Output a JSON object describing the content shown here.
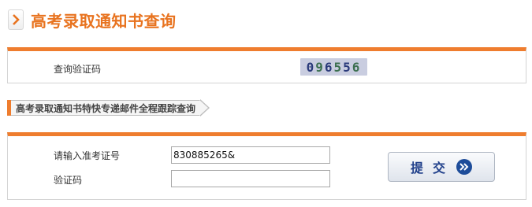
{
  "title": "高考录取通知书查询",
  "captcha_panel": {
    "label": "查询验证码",
    "captcha_digits": [
      "0",
      "9",
      "6",
      "5",
      "5",
      "6"
    ]
  },
  "express_section": {
    "tab_label": "高考录取通知书特快专递邮件全程跟踪查询"
  },
  "form": {
    "exam_number_label": "请输入准考证号",
    "exam_number_value": "830885265&",
    "code_label": "验证码",
    "code_value": "",
    "submit_label": "提交"
  },
  "colors": {
    "accent": "#ef7d2e",
    "title": "#e8731f",
    "button_text": "#1f3f8a"
  },
  "icons": {
    "title_marker": "chevron-right-icon",
    "submit": "double-chevron-right-icon"
  }
}
